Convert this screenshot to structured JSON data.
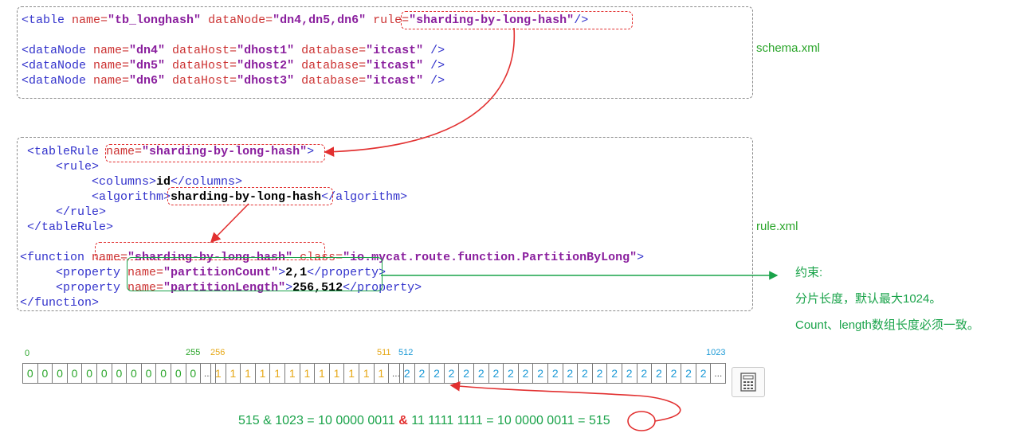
{
  "schema": {
    "file_label": "schema.xml",
    "lines": [
      [
        [
          "tg",
          "<table "
        ],
        [
          "an",
          "name="
        ],
        [
          "sv",
          "\"tb_longhash\""
        ],
        [
          "an",
          " dataNode="
        ],
        [
          "sv",
          "\"dn4,dn5,dn6\""
        ],
        [
          "tg",
          " "
        ],
        [
          "an",
          "rule="
        ],
        [
          "sv",
          "\"sharding-by-long-hash\""
        ],
        [
          "tg",
          "/>"
        ]
      ],
      [],
      [
        [
          "tg",
          "<dataNode "
        ],
        [
          "an",
          "name="
        ],
        [
          "sv",
          "\"dn4\""
        ],
        [
          "an",
          " dataHost="
        ],
        [
          "sv",
          "\"dhost1\""
        ],
        [
          "an",
          " database="
        ],
        [
          "sv",
          "\"itcast\""
        ],
        [
          "tg",
          " />"
        ]
      ],
      [
        [
          "tg",
          "<dataNode "
        ],
        [
          "an",
          "name="
        ],
        [
          "sv",
          "\"dn5\""
        ],
        [
          "an",
          " dataHost="
        ],
        [
          "sv",
          "\"dhost2\""
        ],
        [
          "an",
          " database="
        ],
        [
          "sv",
          "\"itcast\""
        ],
        [
          "tg",
          " />"
        ]
      ],
      [
        [
          "tg",
          "<dataNode "
        ],
        [
          "an",
          "name="
        ],
        [
          "sv",
          "\"dn6\""
        ],
        [
          "an",
          " dataHost="
        ],
        [
          "sv",
          "\"dhost3\""
        ],
        [
          "an",
          " database="
        ],
        [
          "sv",
          "\"itcast\""
        ],
        [
          "tg",
          " />"
        ]
      ]
    ]
  },
  "rule": {
    "file_label": "rule.xml",
    "lines": [
      [
        [
          "tg",
          " <tableRule "
        ],
        [
          "an",
          "name="
        ],
        [
          "sv",
          "\"sharding-by-long-hash\""
        ],
        [
          "tg",
          ">"
        ]
      ],
      [
        [
          "tg",
          "     <rule>"
        ]
      ],
      [
        [
          "tg",
          "          <columns>"
        ],
        [
          "bd",
          "id"
        ],
        [
          "tg",
          "</columns>"
        ]
      ],
      [
        [
          "tg",
          "          <algorithm>"
        ],
        [
          "bd",
          "sharding-by-long-hash"
        ],
        [
          "tg",
          "</algorithm>"
        ]
      ],
      [
        [
          "tg",
          "     </rule>"
        ]
      ],
      [
        [
          "tg",
          " </tableRule>"
        ]
      ],
      [],
      [
        [
          "tg",
          "<function "
        ],
        [
          "an",
          "name="
        ],
        [
          "sv",
          "\"sharding-by-long-hash\""
        ],
        [
          "an",
          " class="
        ],
        [
          "sv",
          "\"io.mycat.route.function.PartitionByLong\""
        ],
        [
          "tg",
          ">"
        ]
      ],
      [
        [
          "tg",
          "     <property "
        ],
        [
          "an",
          "name="
        ],
        [
          "sv",
          "\"partitionCount\""
        ],
        [
          "tg",
          ">"
        ],
        [
          "bd",
          "2,1"
        ],
        [
          "tg",
          "</property>"
        ]
      ],
      [
        [
          "tg",
          "     <property "
        ],
        [
          "an",
          "name="
        ],
        [
          "sv",
          "\"partitionLength\""
        ],
        [
          "tg",
          ">"
        ],
        [
          "bd",
          "256,512"
        ],
        [
          "tg",
          "</property>"
        ]
      ],
      [
        [
          "tg",
          "</function>"
        ]
      ]
    ]
  },
  "constraint": {
    "title": "约束:",
    "line1": "分片长度，默认最大1024。",
    "line2": "Count、length数组长度必须一致。"
  },
  "array": {
    "ticks": [
      "0",
      "255",
      "256",
      "511",
      "512",
      "1023"
    ],
    "groups": [
      {
        "value": "0",
        "count": 12,
        "color": "#2aa52a"
      },
      {
        "value": "1",
        "count": 12,
        "color": "#e6a817"
      },
      {
        "value": "2",
        "count": 21,
        "color": "#1d9ad6"
      }
    ],
    "ellipsis": "..."
  },
  "formula": {
    "left": "515 & 1023 = 10 0000 0011 ",
    "amp": "&",
    "right": " 11 1111 1111 = 10 0000 0011 = ",
    "result": "515"
  },
  "icons": [
    "calculator-icon"
  ],
  "colors": {
    "highlight_red": "#e23030",
    "highlight_green": "#1aa34a",
    "label_green": "#2aa52a"
  }
}
